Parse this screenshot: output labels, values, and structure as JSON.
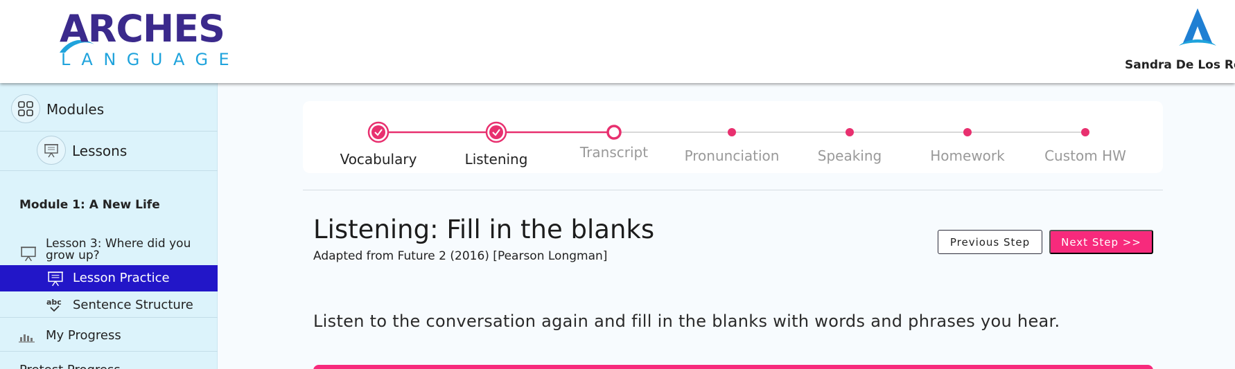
{
  "brand": {
    "title": "ARCHES",
    "subtitle": "LANGUAGE",
    "primary_color": "#3b2a8c",
    "secondary_color": "#1fa3dc"
  },
  "user": {
    "name": "Sandra De Los Reyes",
    "avatar_icon": "arches-a-logo-icon"
  },
  "sidebar": {
    "modules_label": "Modules",
    "lessons_label": "Lessons",
    "module_title": "Module 1: A New Life",
    "lesson_title": "Lesson 3: Where did you grow up?",
    "items": [
      {
        "label": "Lesson Practice",
        "icon": "presentation-board-icon",
        "active": true
      },
      {
        "label": "Sentence Structure",
        "icon": "abc-check-icon",
        "active": false
      }
    ],
    "my_progress_label": "My Progress",
    "next_label": "Pretest Progress",
    "active_color": "#2216c8"
  },
  "stepper": {
    "accent_color": "#e8306f",
    "steps": [
      {
        "label": "Vocabulary",
        "state": "completed"
      },
      {
        "label": "Listening",
        "state": "completed"
      },
      {
        "label": "Transcript",
        "state": "current"
      },
      {
        "label": "Pronunciation",
        "state": "pending"
      },
      {
        "label": "Speaking",
        "state": "pending"
      },
      {
        "label": "Homework",
        "state": "pending"
      },
      {
        "label": "Custom HW",
        "state": "pending"
      }
    ]
  },
  "content": {
    "title": "Listening: Fill in the blanks",
    "subtitle": "Adapted from Future 2 (2016) [Pearson Longman]",
    "prev_button": "Previous Step",
    "next_button": "Next Step >>",
    "instruction": "Listen to the conversation again and fill in the blanks with words and phrases you hear."
  }
}
